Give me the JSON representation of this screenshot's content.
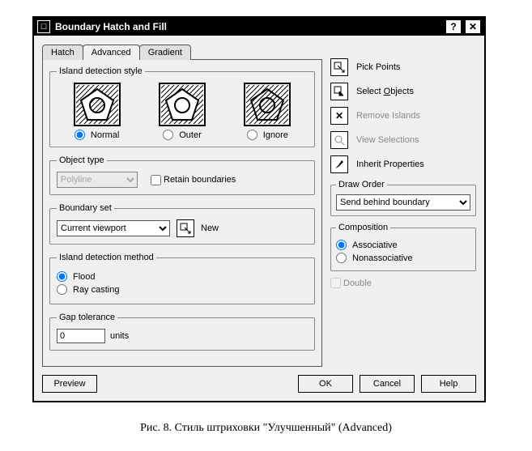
{
  "window": {
    "title": "Boundary Hatch and Fill"
  },
  "tabs": {
    "hatch": "Hatch",
    "advanced": "Advanced",
    "gradient": "Gradient",
    "active": "advanced"
  },
  "island_style": {
    "legend": "Island detection style",
    "options": {
      "normal": "Normal",
      "outer": "Outer",
      "ignore": "Ignore"
    },
    "selected": "normal"
  },
  "object_type": {
    "legend": "Object type",
    "value": "Polyline",
    "retain_label": "Retain boundaries",
    "retain_checked": false
  },
  "boundary_set": {
    "legend": "Boundary set",
    "value": "Current viewport",
    "new_label": "New"
  },
  "detection_method": {
    "legend": "Island detection method",
    "options": {
      "flood": "Flood",
      "raycast": "Ray casting"
    },
    "selected": "flood"
  },
  "gap_tol": {
    "legend": "Gap tolerance",
    "value": "0",
    "units": "units"
  },
  "side": {
    "pick_points": "Pick Points",
    "select_objects": "Select Objects",
    "remove_islands": "Remove Islands",
    "view_selections": "View Selections",
    "inherit": "Inherit Properties"
  },
  "draw_order": {
    "legend": "Draw Order",
    "value": "Send behind boundary"
  },
  "composition": {
    "legend": "Composition",
    "options": {
      "assoc": "Associative",
      "nonassoc": "Nonassociative"
    },
    "selected": "assoc"
  },
  "double": {
    "label": "Double",
    "checked": false
  },
  "buttons": {
    "preview": "Preview",
    "ok": "OK",
    "cancel": "Cancel",
    "help": "Help"
  },
  "caption": "Рис. 8. Стиль штриховки \"Улучшенный\" (Advanced)"
}
